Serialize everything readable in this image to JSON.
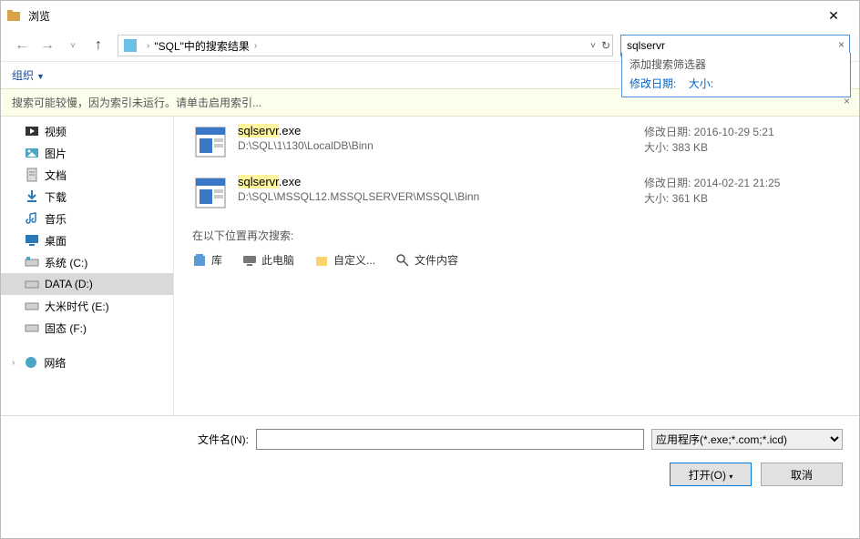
{
  "window": {
    "title": "浏览"
  },
  "nav": {
    "breadcrumb": "\"SQL\"中的搜索结果"
  },
  "search": {
    "value": "sqlservr",
    "dropdown_header": "添加搜索筛选器",
    "filter_date": "修改日期:",
    "filter_size": "大小:"
  },
  "toolbar": {
    "organize": "组织"
  },
  "notice": {
    "text": "搜索可能较慢，因为索引未运行。请单击启用索引..."
  },
  "sidebar": {
    "items": [
      {
        "label": "视频",
        "icon": "video"
      },
      {
        "label": "图片",
        "icon": "picture"
      },
      {
        "label": "文档",
        "icon": "document"
      },
      {
        "label": "下载",
        "icon": "download"
      },
      {
        "label": "音乐",
        "icon": "music"
      },
      {
        "label": "桌面",
        "icon": "desktop"
      },
      {
        "label": "系统 (C:)",
        "icon": "drive-win"
      },
      {
        "label": "DATA (D:)",
        "icon": "drive",
        "selected": true
      },
      {
        "label": "大米时代 (E:)",
        "icon": "drive"
      },
      {
        "label": "固态 (F:)",
        "icon": "drive"
      }
    ],
    "network": "网络"
  },
  "results": [
    {
      "name_hl": "sqlservr",
      "name_rest": ".exe",
      "path": "D:\\SQL\\1\\130\\LocalDB\\Binn",
      "date_label": "修改日期:",
      "date": "2016-10-29 5:21",
      "size_label": "大小:",
      "size": "383 KB"
    },
    {
      "name_hl": "sqlservr",
      "name_rest": ".exe",
      "path": "D:\\SQL\\MSSQL12.MSSQLSERVER\\MSSQL\\Binn",
      "date_label": "修改日期:",
      "date": "2014-02-21 21:25",
      "size_label": "大小:",
      "size": "361 KB"
    }
  ],
  "searchagain": {
    "label": "在以下位置再次搜索:",
    "library": "库",
    "thispc": "此电脑",
    "custom": "自定义...",
    "filecontent": "文件内容"
  },
  "bottom": {
    "filename_label": "文件名(N):",
    "filter": "应用程序(*.exe;*.com;*.icd)",
    "open": "打开(O)",
    "cancel": "取消"
  }
}
